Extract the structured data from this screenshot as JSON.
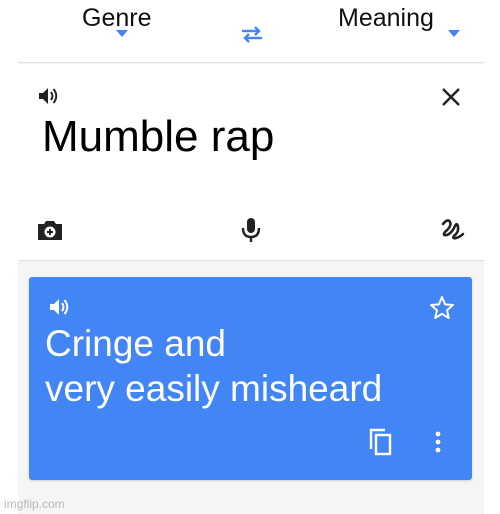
{
  "language_bar": {
    "source_language": "Genre",
    "target_language": "Meaning",
    "swap_icon": "swap-arrows-icon",
    "accent_color": "#4285f4"
  },
  "input_card": {
    "text": "Mumble rap",
    "icons": [
      "speaker-icon",
      "close-icon",
      "camera-icon",
      "microphone-icon",
      "handwriting-icon"
    ]
  },
  "output_card": {
    "text_line1": "Cringe and",
    "text_line2": "very easily misheard",
    "background_color": "#4285f4",
    "icons": [
      "speaker-icon",
      "star-icon",
      "copy-icon",
      "more-vert-icon"
    ]
  },
  "watermark": "imgflip.com"
}
